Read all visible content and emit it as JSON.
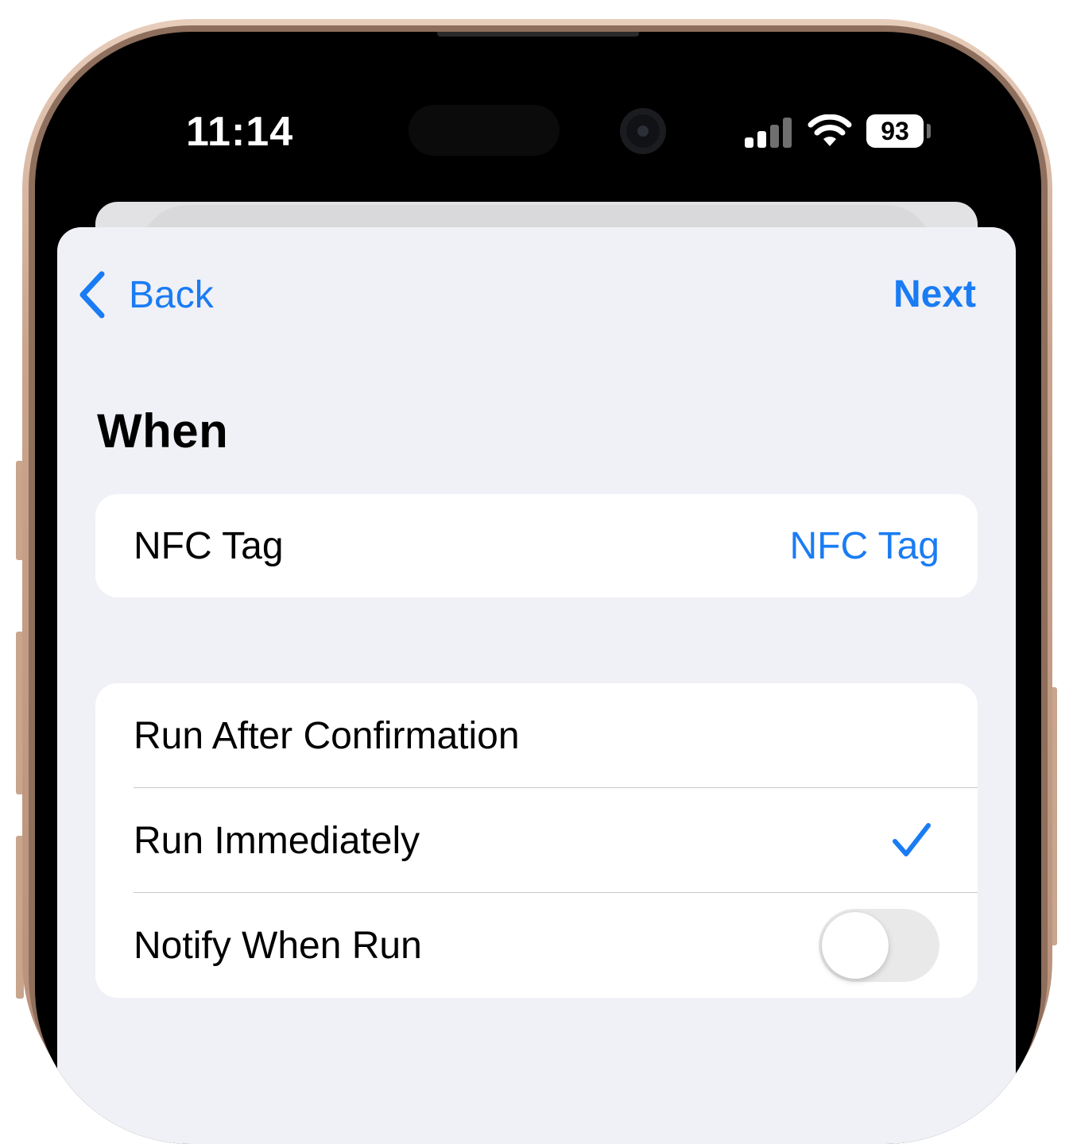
{
  "status_bar": {
    "time": "11:14",
    "battery_level": "93",
    "signal_bars_active": 2,
    "signal_bars_total": 4,
    "wifi": true
  },
  "nav": {
    "back_label": "Back",
    "next_label": "Next"
  },
  "page": {
    "title": "When"
  },
  "trigger_row": {
    "label": "NFC Tag",
    "value": "NFC Tag"
  },
  "options": [
    {
      "label": "Run After Confirmation",
      "selected": false
    },
    {
      "label": "Run Immediately",
      "selected": true
    },
    {
      "label": "Notify When Run",
      "toggle_on": false
    }
  ],
  "colors": {
    "accent": "#1a7cf4",
    "sheet_background": "#f0f1f6",
    "cell_background": "#ffffff",
    "toggle_off": "#e9e9ea"
  }
}
